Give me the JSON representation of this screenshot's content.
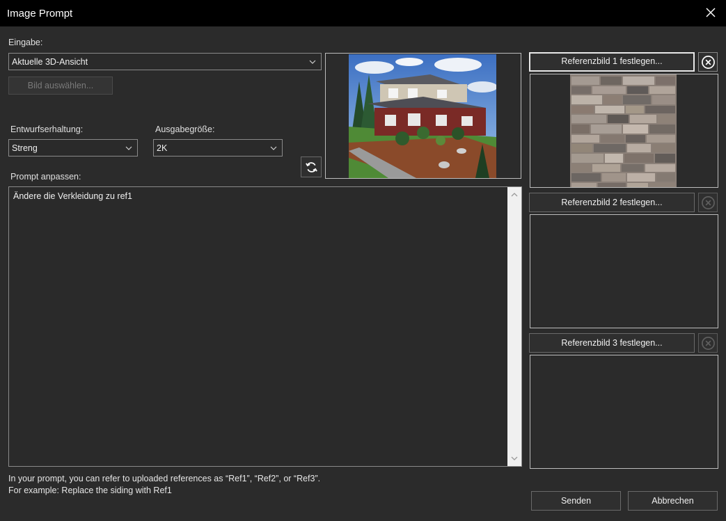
{
  "window": {
    "title": "Image Prompt",
    "close_icon": "close-icon"
  },
  "input": {
    "label": "Eingabe:",
    "source_value": "Aktuelle 3D-Ansicht",
    "select_image_label": "Bild auswählen..."
  },
  "design": {
    "label": "Entwurfserhaltung:",
    "value": "Streng"
  },
  "output": {
    "label": "Ausgabegröße:",
    "value": "2K"
  },
  "prompt": {
    "label": "Prompt anpassen:",
    "value": "Ändere die Verkleidung zu ref1"
  },
  "references": [
    {
      "button_label": "Referenzbild 1 festlegen...",
      "has_image": true
    },
    {
      "button_label": "Referenzbild 2 festlegen...",
      "has_image": false
    },
    {
      "button_label": "Referenzbild 3 festlegen...",
      "has_image": false
    }
  ],
  "hint": {
    "line1": "In your prompt, you can refer to uploaded references as “Ref1”, “Ref2”, or “Ref3”.",
    "line2": "For example: Replace the siding with Ref1"
  },
  "actions": {
    "send_label": "Senden",
    "cancel_label": "Abbrechen"
  },
  "colors": {
    "background": "#2b2b2b",
    "titlebar": "#000000",
    "text": "#e6e6e6"
  }
}
